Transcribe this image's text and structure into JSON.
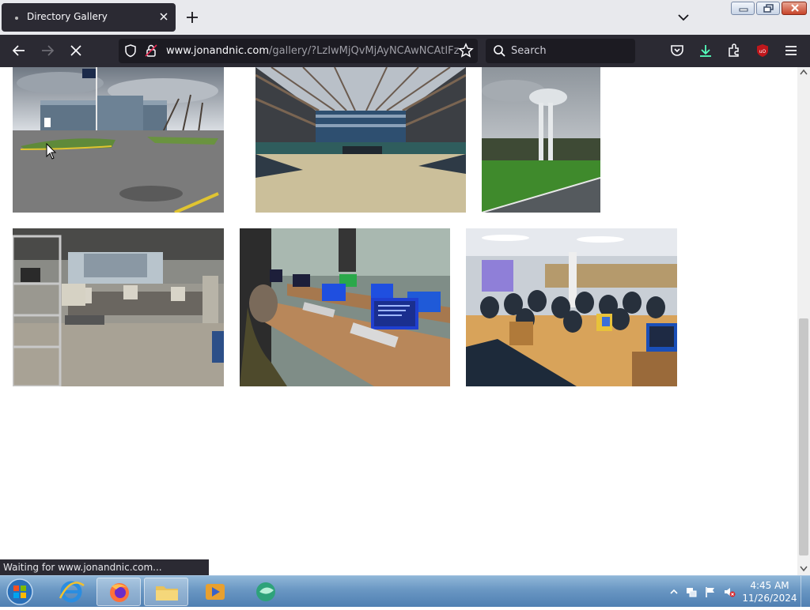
{
  "tab": {
    "title": "Directory Gallery"
  },
  "address": {
    "host": "www.jonandnic.com",
    "path": "/gallery/?LzIwMjQvMjAyNCAwNCAtIFz"
  },
  "search": {
    "placeholder": "Search"
  },
  "status": {
    "text": "Waiting for www.jonandnic.com..."
  },
  "clock": {
    "time": "4:45 AM",
    "date": "11/26/2024"
  },
  "gallery": {
    "photos": [
      {
        "name": "office-building-flagpole"
      },
      {
        "name": "atrium-interior"
      },
      {
        "name": "water-tower"
      },
      {
        "name": "warehouse-computer-collection"
      },
      {
        "name": "computer-lab-desks"
      },
      {
        "name": "auditorium-audience"
      }
    ]
  },
  "icons": [
    "back-icon",
    "forward-icon",
    "stop-icon",
    "shield-icon",
    "lock-icon",
    "star-icon",
    "search-icon",
    "pocket-icon",
    "download-icon",
    "extensions-icon",
    "ublock-icon",
    "menu-icon"
  ],
  "colors": {
    "toolbar": "#2b2a33",
    "urlbar": "#1c1b22",
    "tabstrip": "#e8e9ed",
    "download_accent": "#54ffbd",
    "ublock": "#c0171c"
  }
}
